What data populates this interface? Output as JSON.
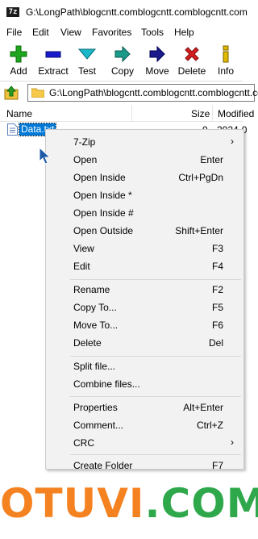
{
  "window": {
    "app_icon": "7z",
    "title": "G:\\LongPath\\blogcntt.comblogcntt.comblogcntt.com"
  },
  "menu": [
    "File",
    "Edit",
    "View",
    "Favorites",
    "Tools",
    "Help"
  ],
  "toolbar": [
    {
      "label": "Add",
      "icon": "plus-icon",
      "color": "#1fa51f"
    },
    {
      "label": "Extract",
      "icon": "minus-icon",
      "color": "#1a1acd"
    },
    {
      "label": "Test",
      "icon": "check-icon",
      "color": "#1ab7c8"
    },
    {
      "label": "Copy",
      "icon": "copy-arrow-icon",
      "color": "#1b9a8a"
    },
    {
      "label": "Move",
      "icon": "move-arrow-icon",
      "color": "#1a1a8c"
    },
    {
      "label": "Delete",
      "icon": "delete-x-icon",
      "color": "#d81e1e"
    },
    {
      "label": "Info",
      "icon": "info-icon",
      "color": "#e0b800"
    }
  ],
  "address": {
    "path": "G:\\LongPath\\blogcntt.comblogcntt.comblogcntt.com"
  },
  "columns": {
    "name": "Name",
    "size": "Size",
    "modified": "Modified"
  },
  "file": {
    "name": "Data.txt",
    "size": "0",
    "modified": "2024-0"
  },
  "context_menu": [
    {
      "label": "7-Zip",
      "shortcut": "",
      "submenu": true
    },
    {
      "label": "Open",
      "shortcut": "Enter"
    },
    {
      "label": "Open Inside",
      "shortcut": "Ctrl+PgDn"
    },
    {
      "label": "Open Inside *",
      "shortcut": ""
    },
    {
      "label": "Open Inside #",
      "shortcut": ""
    },
    {
      "label": "Open Outside",
      "shortcut": "Shift+Enter"
    },
    {
      "label": "View",
      "shortcut": "F3"
    },
    {
      "label": "Edit",
      "shortcut": "F4"
    },
    {
      "separator": true
    },
    {
      "label": "Rename",
      "shortcut": "F2"
    },
    {
      "label": "Copy To...",
      "shortcut": "F5"
    },
    {
      "label": "Move To...",
      "shortcut": "F6"
    },
    {
      "label": "Delete",
      "shortcut": "Del"
    },
    {
      "separator": true
    },
    {
      "label": "Split file...",
      "shortcut": ""
    },
    {
      "label": "Combine files...",
      "shortcut": ""
    },
    {
      "separator": true
    },
    {
      "label": "Properties",
      "shortcut": "Alt+Enter"
    },
    {
      "label": "Comment...",
      "shortcut": "Ctrl+Z"
    },
    {
      "label": "CRC",
      "shortcut": "",
      "submenu": true
    },
    {
      "separator": true
    },
    {
      "label": "Create Folder",
      "shortcut": "F7"
    }
  ],
  "watermark": "OTUVI.COM",
  "colors": {
    "selection": "#0078d7",
    "watermark_orange": "#f58220",
    "watermark_green": "#2ea84a"
  }
}
